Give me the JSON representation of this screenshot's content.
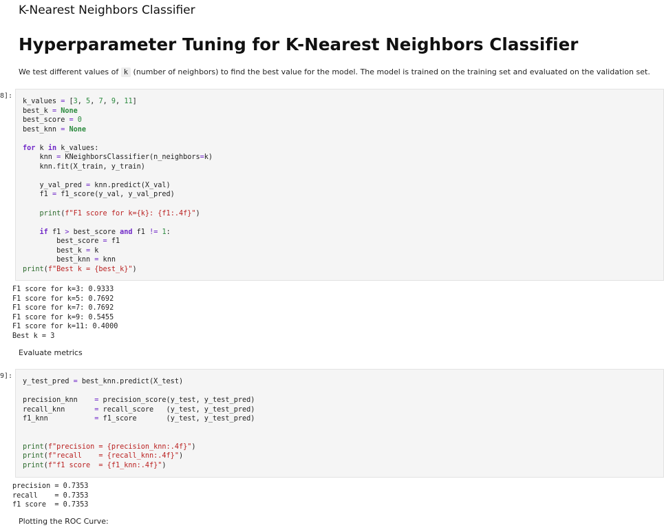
{
  "heading_small": "K-Nearest Neighbors Classifier",
  "heading_main": "Hyperparameter Tuning for K-Nearest Neighbors Classifier",
  "intro": {
    "before": "We test different values of ",
    "code": "k",
    "after": " (number of neighbors) to find the best value for the model. The model is trained on the training set and evaluated on the validation set."
  },
  "cell1": {
    "prompt": "8]:",
    "code": "k_values = [3, 5, 7, 9, 11]\nbest_k = None\nbest_score = 0\nbest_knn = None\n\nfor k in k_values:\n    knn = KNeighborsClassifier(n_neighbors=k)\n    knn.fit(X_train, y_train)\n\n    y_val_pred = knn.predict(X_val)\n    f1 = f1_score(y_val, y_val_pred)\n\n    print(f\"F1 score for k={k}: {f1:.4f}\")\n\n    if f1 > best_score and f1 != 1:\n        best_score = f1\n        best_k = k\n        best_knn = knn\nprint(f\"Best k = {best_k}\")",
    "output": "F1 score for k=3: 0.9333\nF1 score for k=5: 0.7692\nF1 score for k=7: 0.7692\nF1 score for k=9: 0.5455\nF1 score for k=11: 0.4000\nBest k = 3"
  },
  "md_evaluate": "Evaluate metrics",
  "cell2": {
    "prompt": "9]:",
    "code": "y_test_pred = best_knn.predict(X_test)\n\nprecision_knn    = precision_score(y_test, y_test_pred)\nrecall_knn       = recall_score   (y_test, y_test_pred)\nf1_knn           = f1_score       (y_test, y_test_pred)\n\n\nprint(f\"precision = {precision_knn:.4f}\")\nprint(f\"recall    = {recall_knn:.4f}\")\nprint(f\"f1 score  = {f1_knn:.4f}\")",
    "output": "precision = 0.7353\nrecall    = 0.7353\nf1 score  = 0.7353"
  },
  "md_roc": "Plotting the ROC Curve:"
}
